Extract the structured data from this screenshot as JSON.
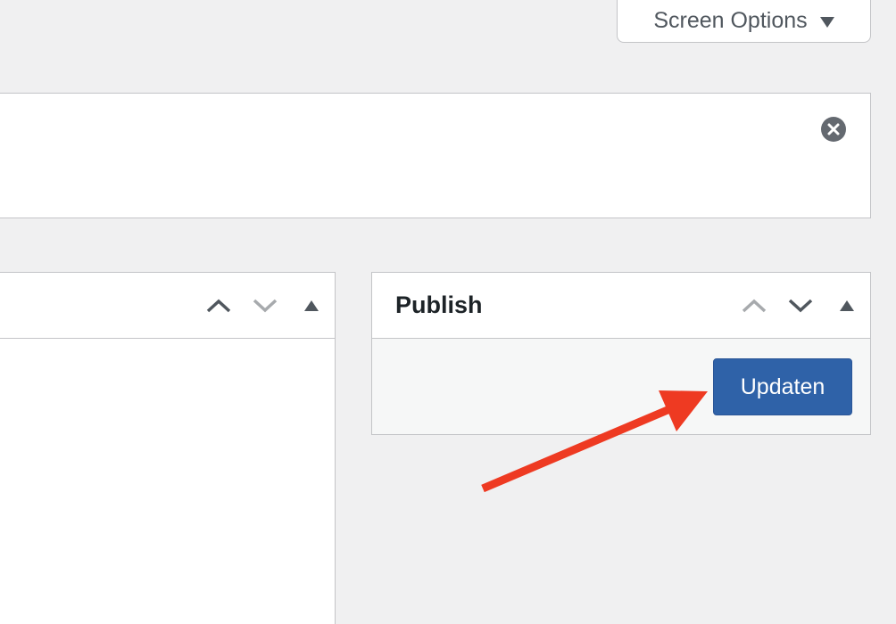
{
  "screen_options": {
    "label": "Screen Options",
    "caret_icon": "caret-down-icon"
  },
  "notice": {
    "dismiss_icon": "dismiss-circle-icon"
  },
  "left_postbox": {
    "title": "",
    "controls": [
      "move-up-icon",
      "move-down-icon",
      "collapse-toggle-icon"
    ]
  },
  "publish_box": {
    "title": "Publish",
    "controls": [
      "move-up-icon",
      "move-down-icon",
      "collapse-toggle-icon"
    ],
    "update_button": "Updaten"
  },
  "annotation": {
    "arrow_color": "#ee3a22",
    "icon": "red-arrow-annotation"
  },
  "colors": {
    "primary_button": "#2f62a8",
    "background": "#f0f0f1",
    "border": "#c3c4c7"
  }
}
